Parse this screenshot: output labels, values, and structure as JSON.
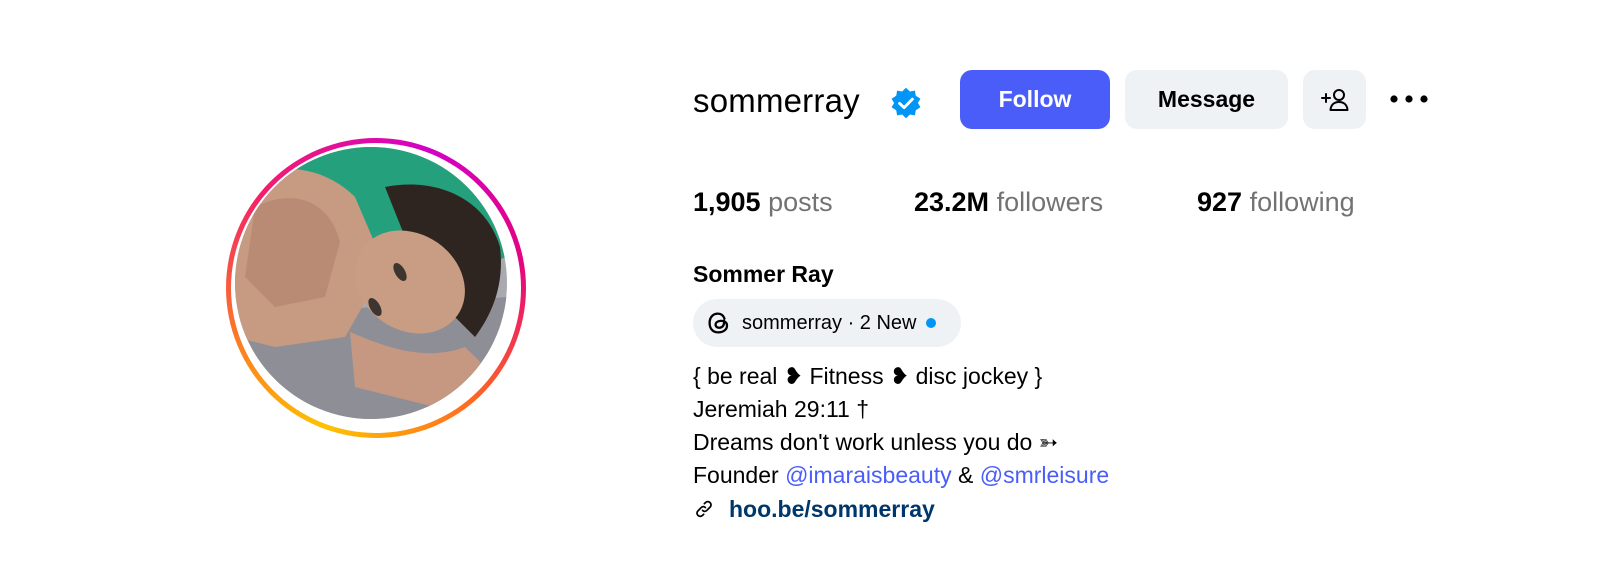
{
  "profile": {
    "username": "sommerray",
    "verified_icon": "verified-badge-icon",
    "full_name": "Sommer Ray",
    "avatar_icon": "profile-photo",
    "ring_colors": [
      "#fec300",
      "#f31e6b",
      "#d400c6"
    ]
  },
  "actions": {
    "follow_label": "Follow",
    "message_label": "Message",
    "add_user_icon": "add-user-icon",
    "more_icon": "more-options-icon"
  },
  "stats": {
    "posts_count": "1,905",
    "posts_label": "posts",
    "followers_count": "23.2M",
    "followers_label": "followers",
    "following_count": "927",
    "following_label": "following"
  },
  "threads": {
    "icon": "threads-icon",
    "label": "sommerray · 2 New"
  },
  "bio": {
    "line1": "{ be real ❥ Fitness ❥ disc jockey }",
    "line2": "Jeremiah 29:11 †",
    "line3": "Dreams don't work unless you do ➳",
    "line4_prefix": "Founder",
    "mention1": "@imaraisbeauty",
    "line4_amp": "&",
    "mention2": "@smrleisure"
  },
  "link": {
    "icon": "link-icon",
    "text": "hoo.be/sommerray"
  },
  "colors": {
    "accent": "#4a5df9",
    "button_secondary_bg": "#eff2f5",
    "muted_text": "#737373",
    "link_text": "#00376b",
    "verified_blue": "#0095f6"
  }
}
